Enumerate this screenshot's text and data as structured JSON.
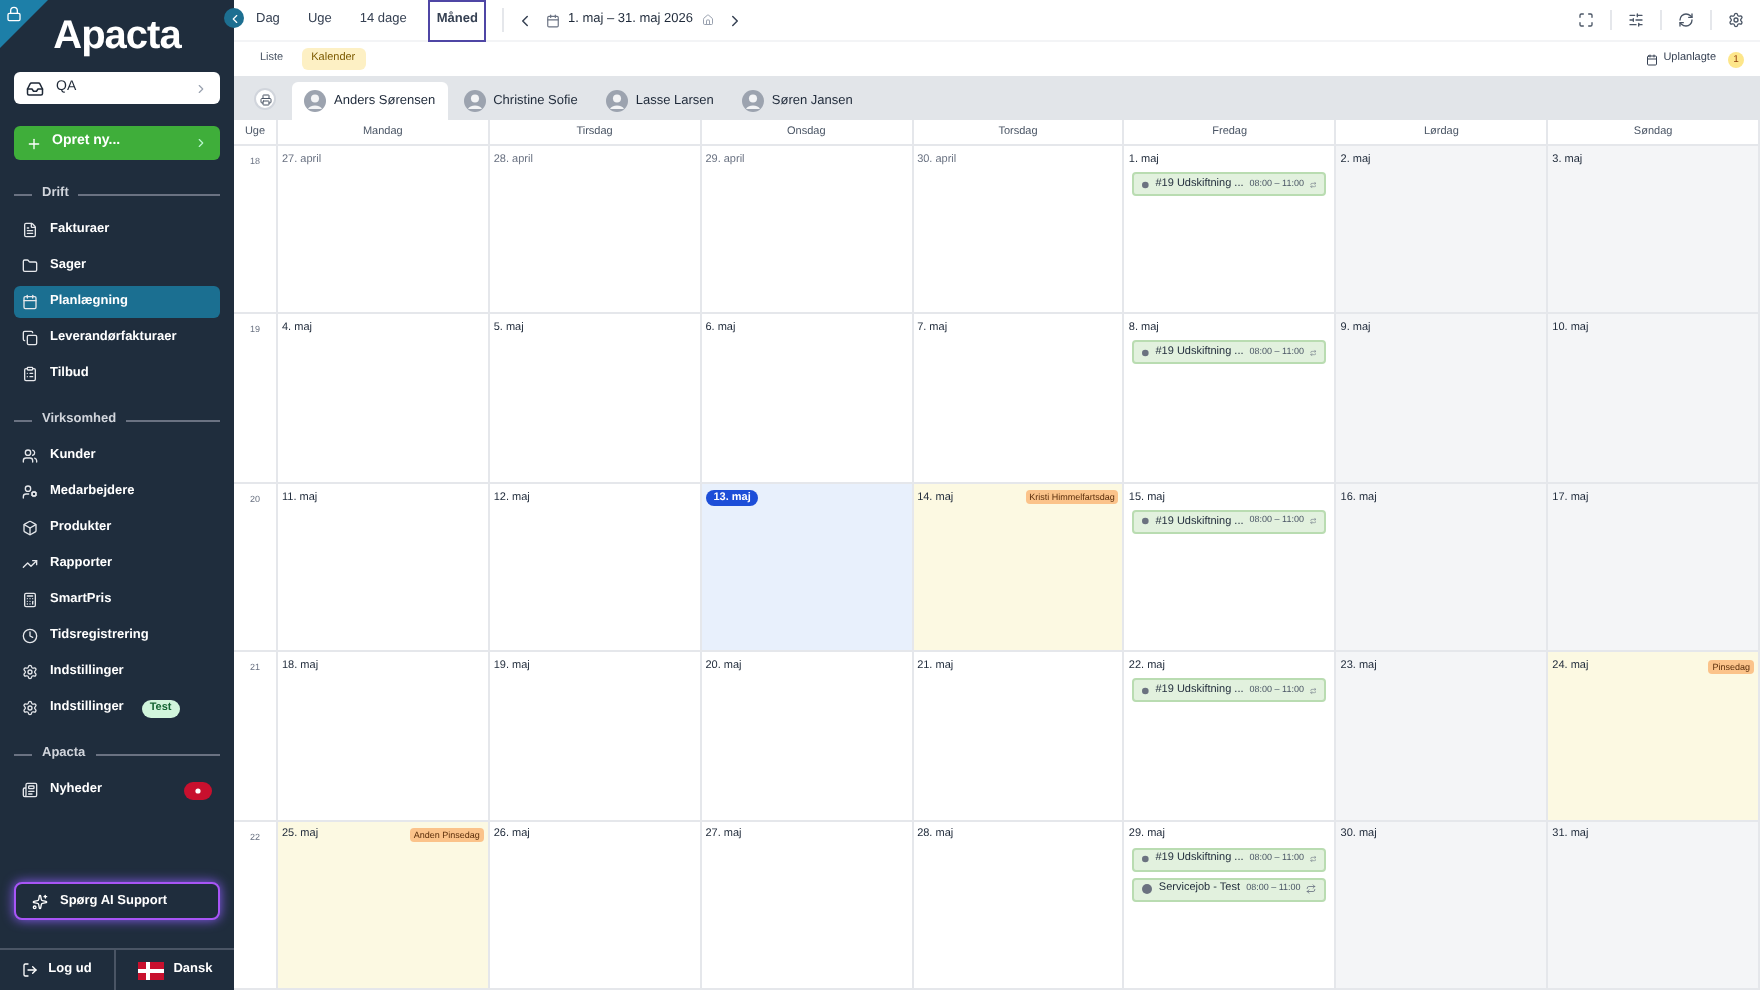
{
  "sidebar": {
    "logo": "Apacta",
    "company": "QA",
    "create_button": "Opret ny...",
    "sections": [
      {
        "title": "Drift",
        "items": [
          {
            "label": "Fakturaer",
            "selected": false
          },
          {
            "label": "Sager",
            "selected": false
          },
          {
            "label": "Planlægning",
            "selected": true
          },
          {
            "label": "Leverandørfakturaer",
            "selected": false
          },
          {
            "label": "Tilbud",
            "selected": false
          }
        ]
      },
      {
        "title": "Virksomhed",
        "items": [
          {
            "label": "Kunder",
            "selected": false
          },
          {
            "label": "Medarbejdere",
            "selected": false
          },
          {
            "label": "Produkter",
            "selected": false
          },
          {
            "label": "Rapporter",
            "selected": false
          },
          {
            "label": "SmartPris",
            "selected": false
          },
          {
            "label": "Tidsregistrering",
            "selected": false
          },
          {
            "label": "Indstillinger",
            "selected": false
          },
          {
            "label": "Indstillinger",
            "selected": false,
            "badge": "Test"
          }
        ]
      },
      {
        "title": "Apacta",
        "items": [
          {
            "label": "Nyheder",
            "selected": false,
            "notification": true
          }
        ]
      }
    ],
    "support_button": "Spørg AI Support",
    "logout": "Log ud",
    "language": "Dansk"
  },
  "toolbar": {
    "views": [
      {
        "label": "Dag",
        "selected": false
      },
      {
        "label": "Uge",
        "selected": false
      },
      {
        "label": "14 dage",
        "selected": false
      },
      {
        "label": "Måned",
        "selected": true
      }
    ],
    "date_range": "1. maj – 31. maj 2026"
  },
  "modes": [
    {
      "label": "Liste",
      "selected": false
    },
    {
      "label": "Kalender",
      "selected": true
    }
  ],
  "unplanned": {
    "label": "Uplanlagte",
    "count": "1"
  },
  "employees": [
    {
      "name": "Anders Sørensen",
      "selected": true
    },
    {
      "name": "Christine Sofie",
      "selected": false
    },
    {
      "name": "Lasse Larsen",
      "selected": false
    },
    {
      "name": "Søren Jansen",
      "selected": false
    }
  ],
  "calendar": {
    "week_label": "Uge",
    "weekdays": [
      "Mandag",
      "Tirsdag",
      "Onsdag",
      "Torsdag",
      "Fredag",
      "Lørdag",
      "Søndag"
    ],
    "weeks": [
      {
        "number": "18",
        "days": [
          {
            "date": "27. april",
            "kind": "muted"
          },
          {
            "date": "28. april",
            "kind": "muted"
          },
          {
            "date": "29. april",
            "kind": "muted"
          },
          {
            "date": "30. april",
            "kind": "muted"
          },
          {
            "date": "1. maj",
            "kind": "day",
            "events": [
              {
                "title": "#19 Udskiftning ...",
                "time": "08:00 – 11:00"
              }
            ]
          },
          {
            "date": "2. maj",
            "kind": "weekend"
          },
          {
            "date": "3. maj",
            "kind": "weekend"
          }
        ]
      },
      {
        "number": "19",
        "days": [
          {
            "date": "4. maj",
            "kind": "day"
          },
          {
            "date": "5. maj",
            "kind": "day"
          },
          {
            "date": "6. maj",
            "kind": "day"
          },
          {
            "date": "7. maj",
            "kind": "day"
          },
          {
            "date": "8. maj",
            "kind": "day",
            "events": [
              {
                "title": "#19 Udskiftning ...",
                "time": "08:00 – 11:00"
              }
            ]
          },
          {
            "date": "9. maj",
            "kind": "weekend"
          },
          {
            "date": "10. maj",
            "kind": "weekend"
          }
        ]
      },
      {
        "number": "20",
        "days": [
          {
            "date": "11. maj",
            "kind": "day"
          },
          {
            "date": "12. maj",
            "kind": "day"
          },
          {
            "date": "13. maj",
            "kind": "today"
          },
          {
            "date": "14. maj",
            "kind": "holiday",
            "holiday": "Kristi Himmelfartsdag"
          },
          {
            "date": "15. maj",
            "kind": "day",
            "events": [
              {
                "title": "#19 Udskiftning ...",
                "time": "08:00 – 11:00"
              }
            ]
          },
          {
            "date": "16. maj",
            "kind": "weekend"
          },
          {
            "date": "17. maj",
            "kind": "weekend"
          }
        ]
      },
      {
        "number": "21",
        "days": [
          {
            "date": "18. maj",
            "kind": "day"
          },
          {
            "date": "19. maj",
            "kind": "day"
          },
          {
            "date": "20. maj",
            "kind": "day"
          },
          {
            "date": "21. maj",
            "kind": "day"
          },
          {
            "date": "22. maj",
            "kind": "day",
            "events": [
              {
                "title": "#19 Udskiftning ...",
                "time": "08:00 – 11:00"
              }
            ]
          },
          {
            "date": "23. maj",
            "kind": "weekend"
          },
          {
            "date": "24. maj",
            "kind": "holiday",
            "holiday": "Pinsedag"
          }
        ]
      },
      {
        "number": "22",
        "days": [
          {
            "date": "25. maj",
            "kind": "holiday",
            "holiday": "Anden Pinsedag"
          },
          {
            "date": "26. maj",
            "kind": "day"
          },
          {
            "date": "27. maj",
            "kind": "day"
          },
          {
            "date": "28. maj",
            "kind": "day"
          },
          {
            "date": "29. maj",
            "kind": "day",
            "events": [
              {
                "title": "#19 Udskiftning ...",
                "time": "08:00 – 11:00"
              },
              {
                "title": "Servicejob - Test",
                "time": "08:00 – 11:00"
              }
            ]
          },
          {
            "date": "30. maj",
            "kind": "weekend"
          },
          {
            "date": "31. maj",
            "kind": "weekend"
          }
        ]
      }
    ]
  }
}
